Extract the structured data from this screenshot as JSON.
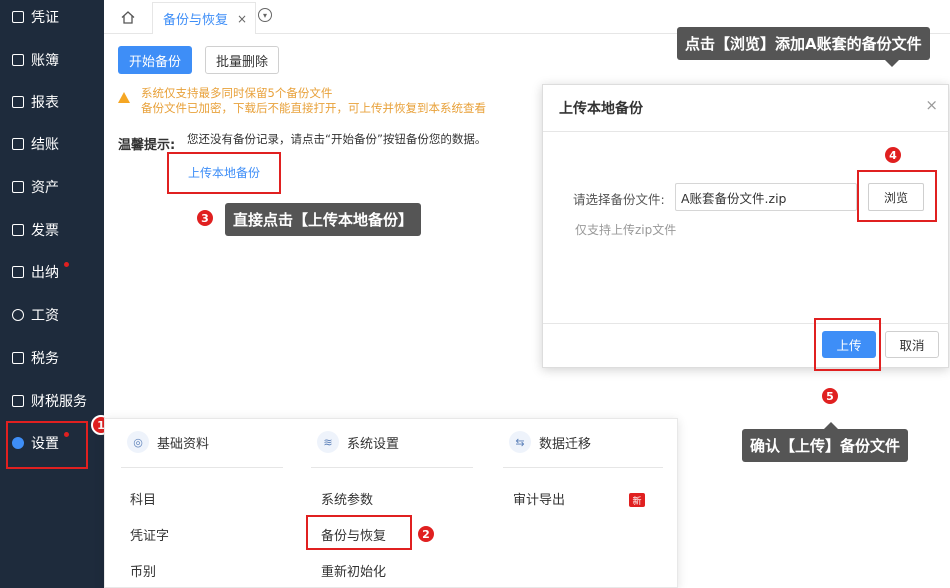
{
  "sidebar": {
    "items": [
      {
        "label": "凭证",
        "icon": "voucher-icon"
      },
      {
        "label": "账簿",
        "icon": "ledger-icon"
      },
      {
        "label": "报表",
        "icon": "report-icon"
      },
      {
        "label": "结账",
        "icon": "closing-icon"
      },
      {
        "label": "资产",
        "icon": "asset-icon"
      },
      {
        "label": "发票",
        "icon": "invoice-icon"
      },
      {
        "label": "出纳",
        "icon": "cashier-icon"
      },
      {
        "label": "工资",
        "icon": "salary-icon"
      },
      {
        "label": "税务",
        "icon": "tax-icon"
      },
      {
        "label": "财税服务",
        "icon": "service-icon"
      },
      {
        "label": "设置",
        "icon": "settings-icon"
      }
    ]
  },
  "tabs": {
    "home_icon": "home-icon",
    "active_tab": "备份与恢复",
    "close_glyph": "×"
  },
  "main": {
    "start_backup": "开始备份",
    "batch_delete": "批量删除",
    "warning_line1": "系统仅支持最多同时保留5个备份文件",
    "warning_line2": "备份文件已加密，下载后不能直接打开，可上传并恢复到本系统查看",
    "tip_title": "温馨提示:",
    "tip_text": "您还没有备份记录，请点击“开始备份”按钮备份您的数据。",
    "upload_local": "上传本地备份"
  },
  "annotations": {
    "badge1": "1",
    "badge2": "2",
    "badge3": "3",
    "badge4": "4",
    "badge5": "5",
    "callout3": "直接点击【上传本地备份】",
    "callout_top": "点击【浏览】添加A账套的备份文件",
    "callout5": "确认【上传】备份文件"
  },
  "dialog": {
    "title": "上传本地备份",
    "close_glyph": "×",
    "file_label": "请选择备份文件:",
    "file_value": "A账套备份文件.zip",
    "browse": "浏览",
    "hint": "仅支持上传zip文件",
    "upload": "上传",
    "cancel": "取消"
  },
  "settings_menu": {
    "col1": {
      "header": "基础资料",
      "items": [
        "科目",
        "凭证字",
        "币别"
      ]
    },
    "col2": {
      "header": "系统设置",
      "items": [
        "系统参数",
        "备份与恢复",
        "重新初始化"
      ]
    },
    "col3": {
      "header": "数据迁移",
      "items": [
        "审计导出"
      ],
      "new_badge": "新"
    }
  },
  "colors": {
    "sidebar_bg": "#1e2b3c",
    "primary": "#3e8ef7",
    "annotation_red": "#e02020",
    "warning": "#e8a13a"
  }
}
